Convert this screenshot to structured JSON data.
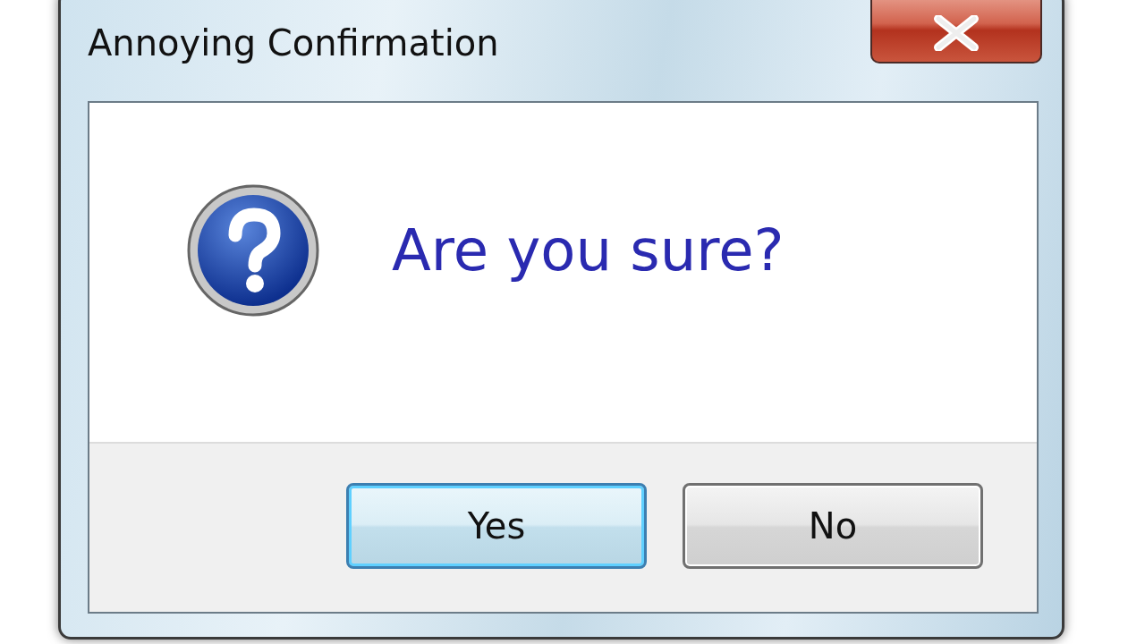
{
  "window": {
    "title": "Annoying Confirmation"
  },
  "message": "Are you sure?",
  "buttons": [
    {
      "label": "Yes",
      "default": true
    },
    {
      "label": "No",
      "default": false
    }
  ]
}
